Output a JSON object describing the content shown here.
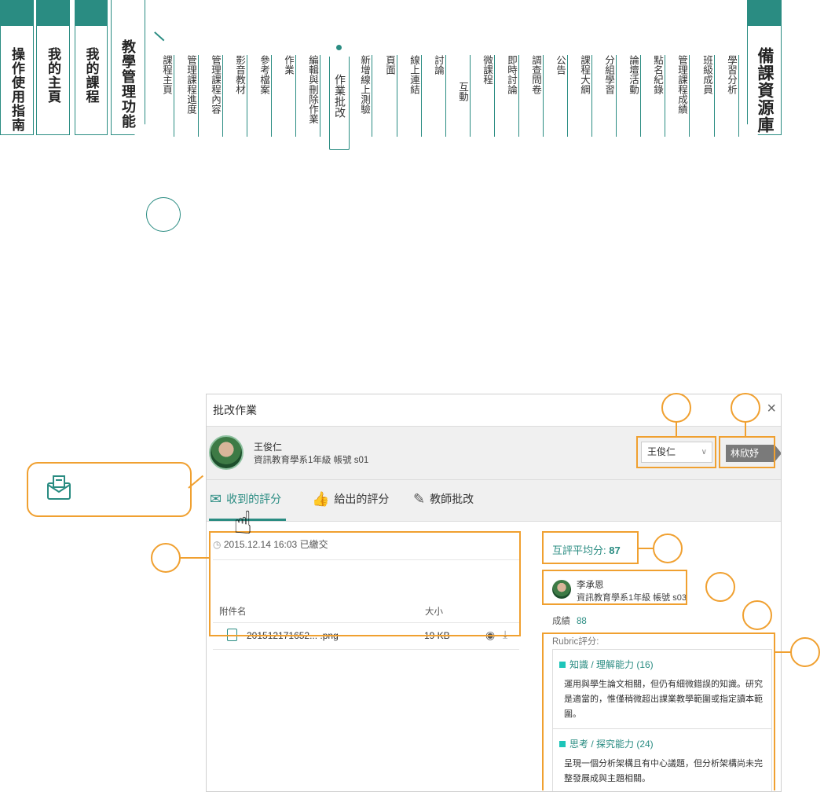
{
  "top_tabs": [
    {
      "label": "操作使用指南"
    },
    {
      "label": "我的主頁"
    },
    {
      "label": "我的課程"
    },
    {
      "label": "教學管理功能"
    },
    {
      "label": "備課資源庫"
    }
  ],
  "sub_menu": [
    "課程主頁",
    "管理課程進度",
    "管理課程內容",
    "影音教材",
    "參考檔案",
    "作業",
    "編輯與刪除作業",
    "作業批改",
    "新增線上測驗",
    "頁面",
    "線上連結",
    "討論",
    "互動",
    "微課程",
    "即時討論",
    "調查問卷",
    "公告",
    "課程大綱",
    "分組學習",
    "論壇活動",
    "點名紀錄",
    "管理課程成績",
    "班級成員",
    "學習分析"
  ],
  "active_sub_menu": "作業批改",
  "dialog": {
    "title": "批改作業",
    "close_icon": "×",
    "student": {
      "name": "王俊仁",
      "info": "資訊教育學系1年級 帳號 s01"
    },
    "select_value": "王俊仁",
    "next_student": "林欣妤",
    "tabs": [
      {
        "label": "收到的評分",
        "icon": "inbox-icon"
      },
      {
        "label": "給出的評分",
        "icon": "thumbs-up-icon"
      },
      {
        "label": "教師批改",
        "icon": "edit-icon"
      }
    ],
    "submitted": "2015.12.14 16:03 已繳交",
    "table": {
      "col_name": "附件名",
      "col_size": "大小",
      "rows": [
        {
          "name": "201512171652... .png",
          "size": "19 KB"
        }
      ]
    },
    "peer_avg_label": "互評平均分:",
    "peer_avg_value": "87",
    "reviewer": {
      "name": "李承恩",
      "info": "資訊教育學系1年級 帳號 s03"
    },
    "score_label": "成績",
    "score_value": "88",
    "rubric_label": "Rubric評分:",
    "rubrics": [
      {
        "title": "知識 / 理解能力 (16)",
        "text": "運用與學生論文相關，但仍有細微錯誤的知識。研究是適當的，惟僅稍微超出課業教學範圍或指定讀本範圍。"
      },
      {
        "title": "思考 / 探究能力 (24)",
        "text": "呈現一個分析架構且有中心議題，但分析架構尚未完整發展成與主題相關。"
      }
    ]
  },
  "colors": {
    "teal": "#2a8c82",
    "orange": "#f0a030",
    "gray_btn": "#7a7a7a"
  }
}
